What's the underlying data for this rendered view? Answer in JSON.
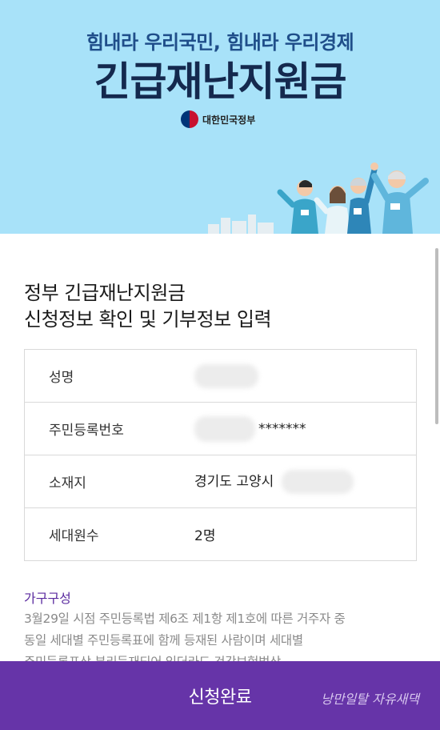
{
  "banner": {
    "slogan": "힘내라 우리국민, 힘내라 우리경제",
    "title": "긴급재난지원금",
    "gov_label": "대한민국정부"
  },
  "form": {
    "heading_line1": "정부 긴급재난지원금",
    "heading_line2": "신청정보 확인 및 기부정보 입력",
    "rows": [
      {
        "label": "성명",
        "value": ""
      },
      {
        "label": "주민등록번호",
        "value": "*******"
      },
      {
        "label": "소재지",
        "value": "경기도 고양시"
      },
      {
        "label": "세대원수",
        "value": "2명"
      }
    ],
    "section_title": "가구구성",
    "section_desc_line1": "3월29일 시점 주민등록법 제6조 제1항 제1호에 따른 거주자 중",
    "section_desc_line2": "동일 세대별 주민등록표에 함께 등재된 사람이며 세대별",
    "section_desc_line3": "주민등록표상 분리등재되어 있더라도 건강보험법상"
  },
  "footer": {
    "submit_label": "신청완료",
    "watermark": "낭만일탈 자유새댁"
  },
  "colors": {
    "banner_bg": "#a8e2f9",
    "title": "#14294e",
    "accent": "#6634a8",
    "section_title": "#5a2a9f"
  },
  "icons": [
    "taegeuk-logo-icon",
    "cheering-people-illustration"
  ]
}
